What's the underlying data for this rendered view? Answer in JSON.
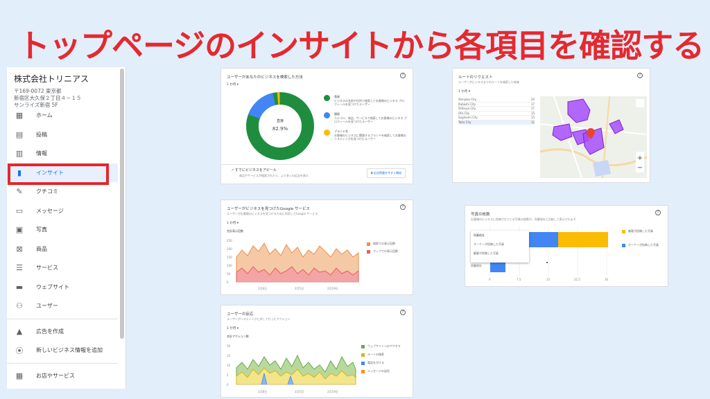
{
  "headline": "トップページのインサイトから各項目を確認する",
  "sidebar": {
    "business_name": "株式会社トリニアス",
    "address": "〒169-0072 東京都\n新宿区大久保２丁目４－１５\nサンライズ新宿 5F",
    "items": [
      {
        "label": "ホーム",
        "icon": "dashboard-icon"
      },
      {
        "label": "投稿",
        "icon": "post-icon"
      },
      {
        "label": "情報",
        "icon": "store-icon"
      },
      {
        "label": "インサイト",
        "icon": "bar-chart-icon"
      },
      {
        "label": "クチコミ",
        "icon": "review-icon"
      },
      {
        "label": "メッセージ",
        "icon": "message-icon"
      },
      {
        "label": "写真",
        "icon": "photo-icon"
      },
      {
        "label": "商品",
        "icon": "basket-icon"
      },
      {
        "label": "サービス",
        "icon": "list-icon"
      },
      {
        "label": "ウェブサイト",
        "icon": "web-icon"
      },
      {
        "label": "ユーザー",
        "icon": "add-user-icon"
      },
      {
        "label": "広告を作成",
        "icon": "ads-icon"
      },
      {
        "label": "新しいビジネス情報を追加",
        "icon": "location-pin-icon"
      },
      {
        "label": "お店やサービス",
        "icon": "shop-icon"
      }
    ]
  },
  "card_search": {
    "title": "ユーザーがあなたのビジネスを検索した方法",
    "period": "1 か月",
    "donut_center_label": "直接",
    "donut_center_value": "82.9%",
    "legend": [
      {
        "name": "直接",
        "desc": "ビジネスの名前や住所で検索してお客様のビジネス プロフィールを見つけたユーザー",
        "color": "#1e8e3e"
      },
      {
        "name": "間接",
        "desc": "カテゴリ、商品、サービスで検索してお客様のビジネス プロフィールを見つけたユーザー",
        "color": "#4285f4"
      },
      {
        "name": "ブランド名",
        "desc": "お客様のビジネスに関連するブランドを検索してお客様のリスティングを見つけたユーザー",
        "color": "#fbbc04"
      }
    ],
    "footer_title": "すでにビジネスをアピール",
    "footer_desc": "商品やサービスが検索されたら、より多くの広告を表示",
    "footer_button": "広告掲載を今すぐ開始"
  },
  "card_route": {
    "title": "ルートのリクエスト",
    "subtitle": "ユーザーがビジネスまでのルートを検索した地域",
    "period": "1 か月",
    "rows": [
      {
        "city": "Shinjuku City",
        "count": "20"
      },
      {
        "city": "Itabashi City",
        "count": "17"
      },
      {
        "city": "Shibuya City",
        "count": "17"
      },
      {
        "city": "Ota City",
        "count": "15"
      },
      {
        "city": "Suginami City",
        "count": "15"
      },
      {
        "city": "Taito City",
        "count": "12"
      }
    ]
  },
  "card_service": {
    "title": "ユーザーがビジネスを見つけたGoogle サービス",
    "subtitle": "ユーザーがお客様のビジネスを見つけるために利用したGoogle サービス",
    "period": "1 か月",
    "total_label": "合計表示回数",
    "legend": [
      "検索での表示回数",
      "マップでの表示回数"
    ],
    "y_ticks": [
      "250",
      "200",
      "150",
      "100",
      "50",
      "0"
    ],
    "x_ticks": [
      "1月8日",
      "2月5日",
      "2月19日"
    ]
  },
  "card_photos": {
    "title": "写真の枚数",
    "subtitle": "お客様のビジネスに投稿されている写真の枚数が、同業他社と比較して表示されます",
    "legend": [
      "顧客が投稿した写真",
      "オーナーが投稿した写真"
    ],
    "tooltip_title": "同業他社",
    "tooltip_lines": [
      "オーナーが投稿した写真",
      "顧客が投稿した写真"
    ],
    "row_label": "同業他社",
    "x_ticks": [
      "0",
      "7.5",
      "15",
      "22.5",
      "30"
    ]
  },
  "card_actions": {
    "title": "ユーザーの反応",
    "subtitle": "ユーザーがリスティングに対して行ったアクション",
    "period": "1 か月",
    "total_label": "合計アクション数",
    "legend": [
      "ウェブサイトへのアクセス",
      "ルートの検索",
      "電話をかける",
      "メッセージの送信"
    ],
    "y_ticks": [
      "20",
      "15",
      "10",
      "5",
      "0"
    ],
    "x_ticks": [
      "1月8日",
      "2月5日",
      "2月19日"
    ]
  }
}
